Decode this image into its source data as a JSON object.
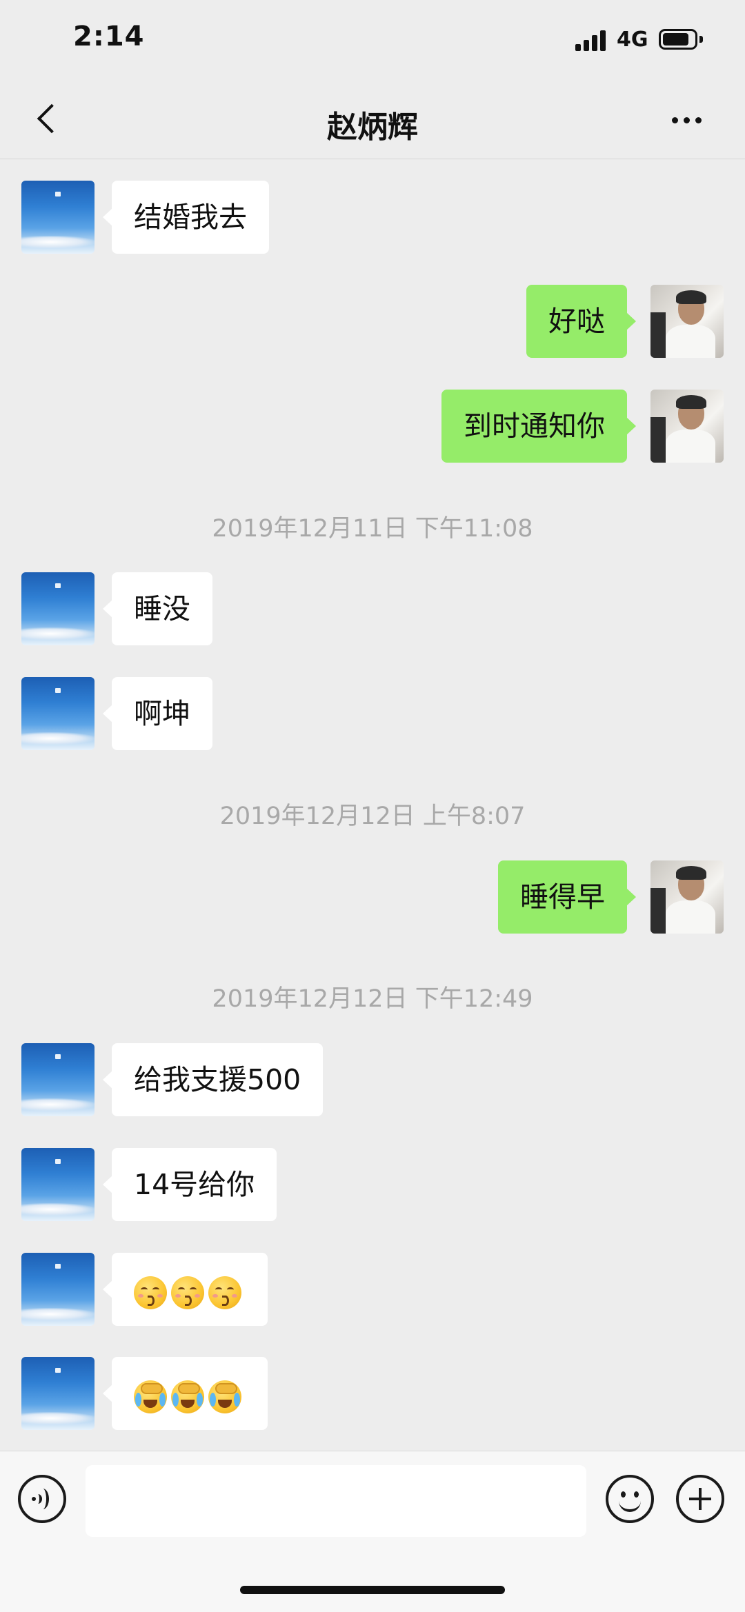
{
  "status_bar": {
    "time": "2:14",
    "network": "4G",
    "battery_level": 0.85
  },
  "nav": {
    "title": "赵炳辉",
    "back_icon": "chevron-left-icon",
    "more_icon": "more-dots-icon"
  },
  "messages": [
    {
      "side": "left",
      "text": "结婚我去"
    },
    {
      "side": "right",
      "text": "好哒"
    },
    {
      "side": "right",
      "text": "到时通知你"
    },
    {
      "type": "timestamp",
      "text": "2019年12月11日 下午11:08"
    },
    {
      "side": "left",
      "text": "睡没"
    },
    {
      "side": "left",
      "text": "啊坤"
    },
    {
      "type": "timestamp",
      "text": "2019年12月12日 上午8:07"
    },
    {
      "side": "right",
      "text": "睡得早"
    },
    {
      "type": "timestamp",
      "text": "2019年12月12日 下午12:49"
    },
    {
      "side": "left",
      "text": "给我支援500"
    },
    {
      "side": "left",
      "text": "14号给你"
    },
    {
      "side": "left",
      "emoji": [
        "kissing-face-icon",
        "kissing-face-icon",
        "kissing-face-icon"
      ]
    },
    {
      "side": "left",
      "emoji": [
        "crying-face-icon",
        "crying-face-icon",
        "crying-face-icon"
      ]
    }
  ],
  "input_bar": {
    "value": "",
    "voice_icon": "voice-icon",
    "emoji_icon": "smiley-icon",
    "plus_icon": "plus-icon"
  },
  "colors": {
    "background": "#ededed",
    "own_bubble": "#95ec69",
    "other_bubble": "#ffffff",
    "timestamp_text": "#a8a8a8"
  }
}
